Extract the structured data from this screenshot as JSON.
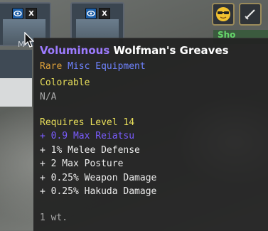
{
  "slots": [
    {
      "eye_icon": "eye-icon",
      "close_label": "X",
      "caption": "M"
    },
    {
      "eye_icon": "eye-icon",
      "close_label": "X"
    }
  ],
  "toolbar": {
    "buttons": [
      {
        "icon": "sunglasses-emoji-icon"
      },
      {
        "icon": "sword-icon"
      }
    ]
  },
  "shop_tab": {
    "label": "Sho"
  },
  "tooltip": {
    "title_quality": "Voluminous",
    "title_name": "Wolfman's Greaves",
    "rarity": "Rare",
    "category": "Misc Equipment",
    "colorable_label": "Colorable",
    "colorable_value": "N/A",
    "requirement": "Requires Level 14",
    "stats": [
      {
        "text": "+ 0.9 Max Reiatsu",
        "color": "#7a5cff"
      },
      {
        "text": "+ 1% Melee Defense",
        "color": "#ececec"
      },
      {
        "text": "+ 2 Max Posture",
        "color": "#ececec"
      },
      {
        "text": "+ 0.25% Weapon Damage",
        "color": "#ececec"
      },
      {
        "text": "+ 0.25% Hakuda Damage",
        "color": "#ececec"
      }
    ],
    "weight": "1 wt."
  },
  "colors": {
    "quality": "#9d7bff",
    "rarity": "#e0a23a",
    "category": "#6f83ff",
    "highlight": "#e9df5a"
  }
}
